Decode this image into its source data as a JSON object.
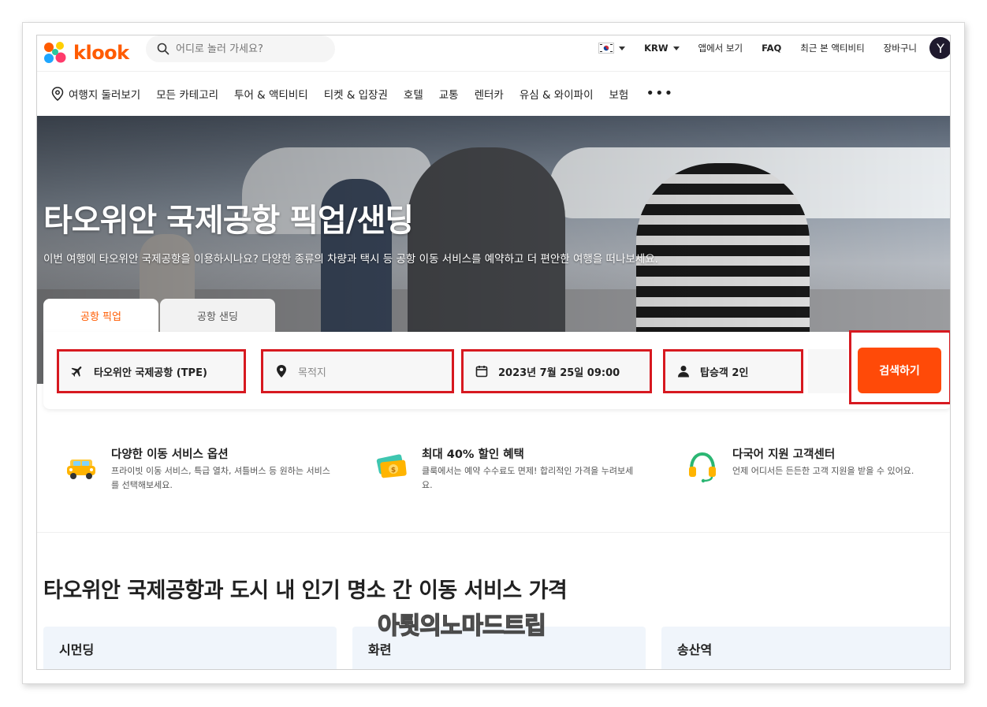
{
  "brand": {
    "name": "klook"
  },
  "search": {
    "placeholder": "어디로 놀러 가세요?"
  },
  "topbar": {
    "currency": "KRW",
    "app": "앱에서 보기",
    "faq": "FAQ",
    "recent": "최근 본 액티비티",
    "cart": "장바구니",
    "avatar_initial": "Y"
  },
  "nav": {
    "items": [
      "여행지 둘러보기",
      "모든 카테고리",
      "투어 & 액티비티",
      "티켓 & 입장권",
      "호텔",
      "교통",
      "렌터카",
      "유심 & 와이파이",
      "보험"
    ],
    "more": "•••"
  },
  "hero": {
    "title": "타오위안 국제공항 픽업/샌딩",
    "subtitle": "이번 여행에 타오위안 국제공항을 이용하시나요? 다양한 종류의 차량과 택시 등 공항 이동 서비스를 예약하고 더 편안한 여행을 떠나보세요."
  },
  "tabs": {
    "pickup": "공항 픽업",
    "sending": "공항 샌딩"
  },
  "booking": {
    "from": "타오위안 국제공항 (TPE)",
    "to_placeholder": "목적지",
    "datetime": "2023년 7월 25일 09:00",
    "passengers": "탑승객 2인",
    "search_button": "검색하기"
  },
  "features": [
    {
      "icon": "car-icon",
      "title": "다양한 이동 서비스 옵션",
      "desc": "프라이빗 이동 서비스, 특급 열차, 셔틀버스 등 원하는 서비스를 선택해보세요."
    },
    {
      "icon": "discount-ticket-icon",
      "title": "최대 40% 할인 혜택",
      "desc": "클룩에서는 예약 수수료도 면제! 합리적인 가격을 누려보세요."
    },
    {
      "icon": "headset-icon",
      "title": "다국어 지원 고객센터",
      "desc": "언제 어디서든 든든한 고객 지원을 받을 수 있어요."
    }
  ],
  "section": {
    "title": "타오위안 국제공항과 도시 내 인기 명소 간 이동 서비스 가격",
    "cards": [
      "시먼딩",
      "화련",
      "송산역"
    ]
  },
  "watermark": "아툇의노마드트립",
  "colors": {
    "accent": "#ff5b00",
    "highlight": "#d71920",
    "button": "#ff4a08"
  }
}
